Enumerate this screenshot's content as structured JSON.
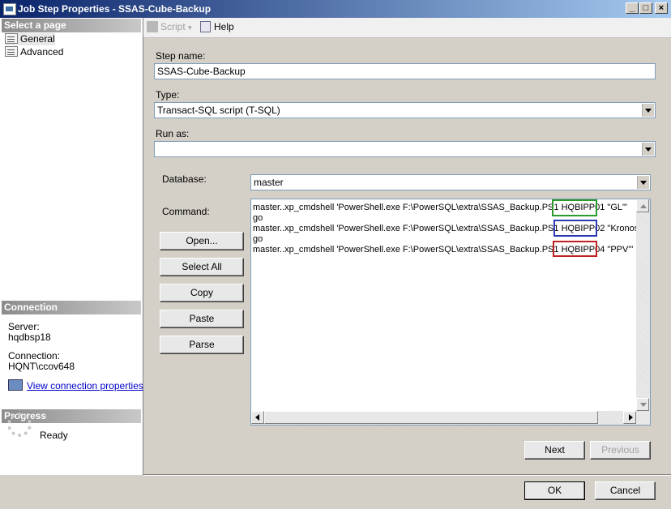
{
  "window": {
    "title": "Job Step Properties - SSAS-Cube-Backup"
  },
  "toolbar": {
    "script_label": "Script",
    "help_label": "Help"
  },
  "left_panel": {
    "select_page_header": "Select a page",
    "pages": [
      {
        "label": "General"
      },
      {
        "label": "Advanced"
      }
    ],
    "connection_header": "Connection",
    "server_label": "Server:",
    "server_value": "hqdbsp18",
    "connection_label": "Connection:",
    "connection_value": "HQNT\\ccov648",
    "view_connection_link": "View connection properties",
    "progress_header": "Progress",
    "progress_status": "Ready"
  },
  "form": {
    "step_name_label": "Step name:",
    "step_name_value": "SSAS-Cube-Backup",
    "type_label": "Type:",
    "type_value": "Transact-SQL script (T-SQL)",
    "run_as_label": "Run as:",
    "run_as_value": "",
    "database_label": "Database:",
    "database_value": "master",
    "command_label": "Command:"
  },
  "command": {
    "lines": [
      {
        "prefix": "master..xp_cmdshell 'PowerShell.exe F:\\PowerSQL\\extra\\SSAS_Backup.PS1 ",
        "server": "HQBIPP01",
        "suffix": " \"GL\"'"
      },
      {
        "text": "go"
      },
      {
        "prefix": "master..xp_cmdshell 'PowerShell.exe F:\\PowerSQL\\extra\\SSAS_Backup.PS1 ",
        "server": "HQBIPP02",
        "suffix": " \"Kronos\"'"
      },
      {
        "text": "go"
      },
      {
        "prefix": "master..xp_cmdshell 'PowerShell.exe F:\\PowerSQL\\extra\\SSAS_Backup.PS1 ",
        "server": "HQBIPP04",
        "suffix": " \"PPV\"'"
      }
    ],
    "highlight_colors": [
      "#2a9a2a",
      "#2a3ab0",
      "#c02020"
    ]
  },
  "buttons": {
    "open": "Open...",
    "select_all": "Select All",
    "copy": "Copy",
    "paste": "Paste",
    "parse": "Parse",
    "next": "Next",
    "previous": "Previous",
    "ok": "OK",
    "cancel": "Cancel"
  }
}
